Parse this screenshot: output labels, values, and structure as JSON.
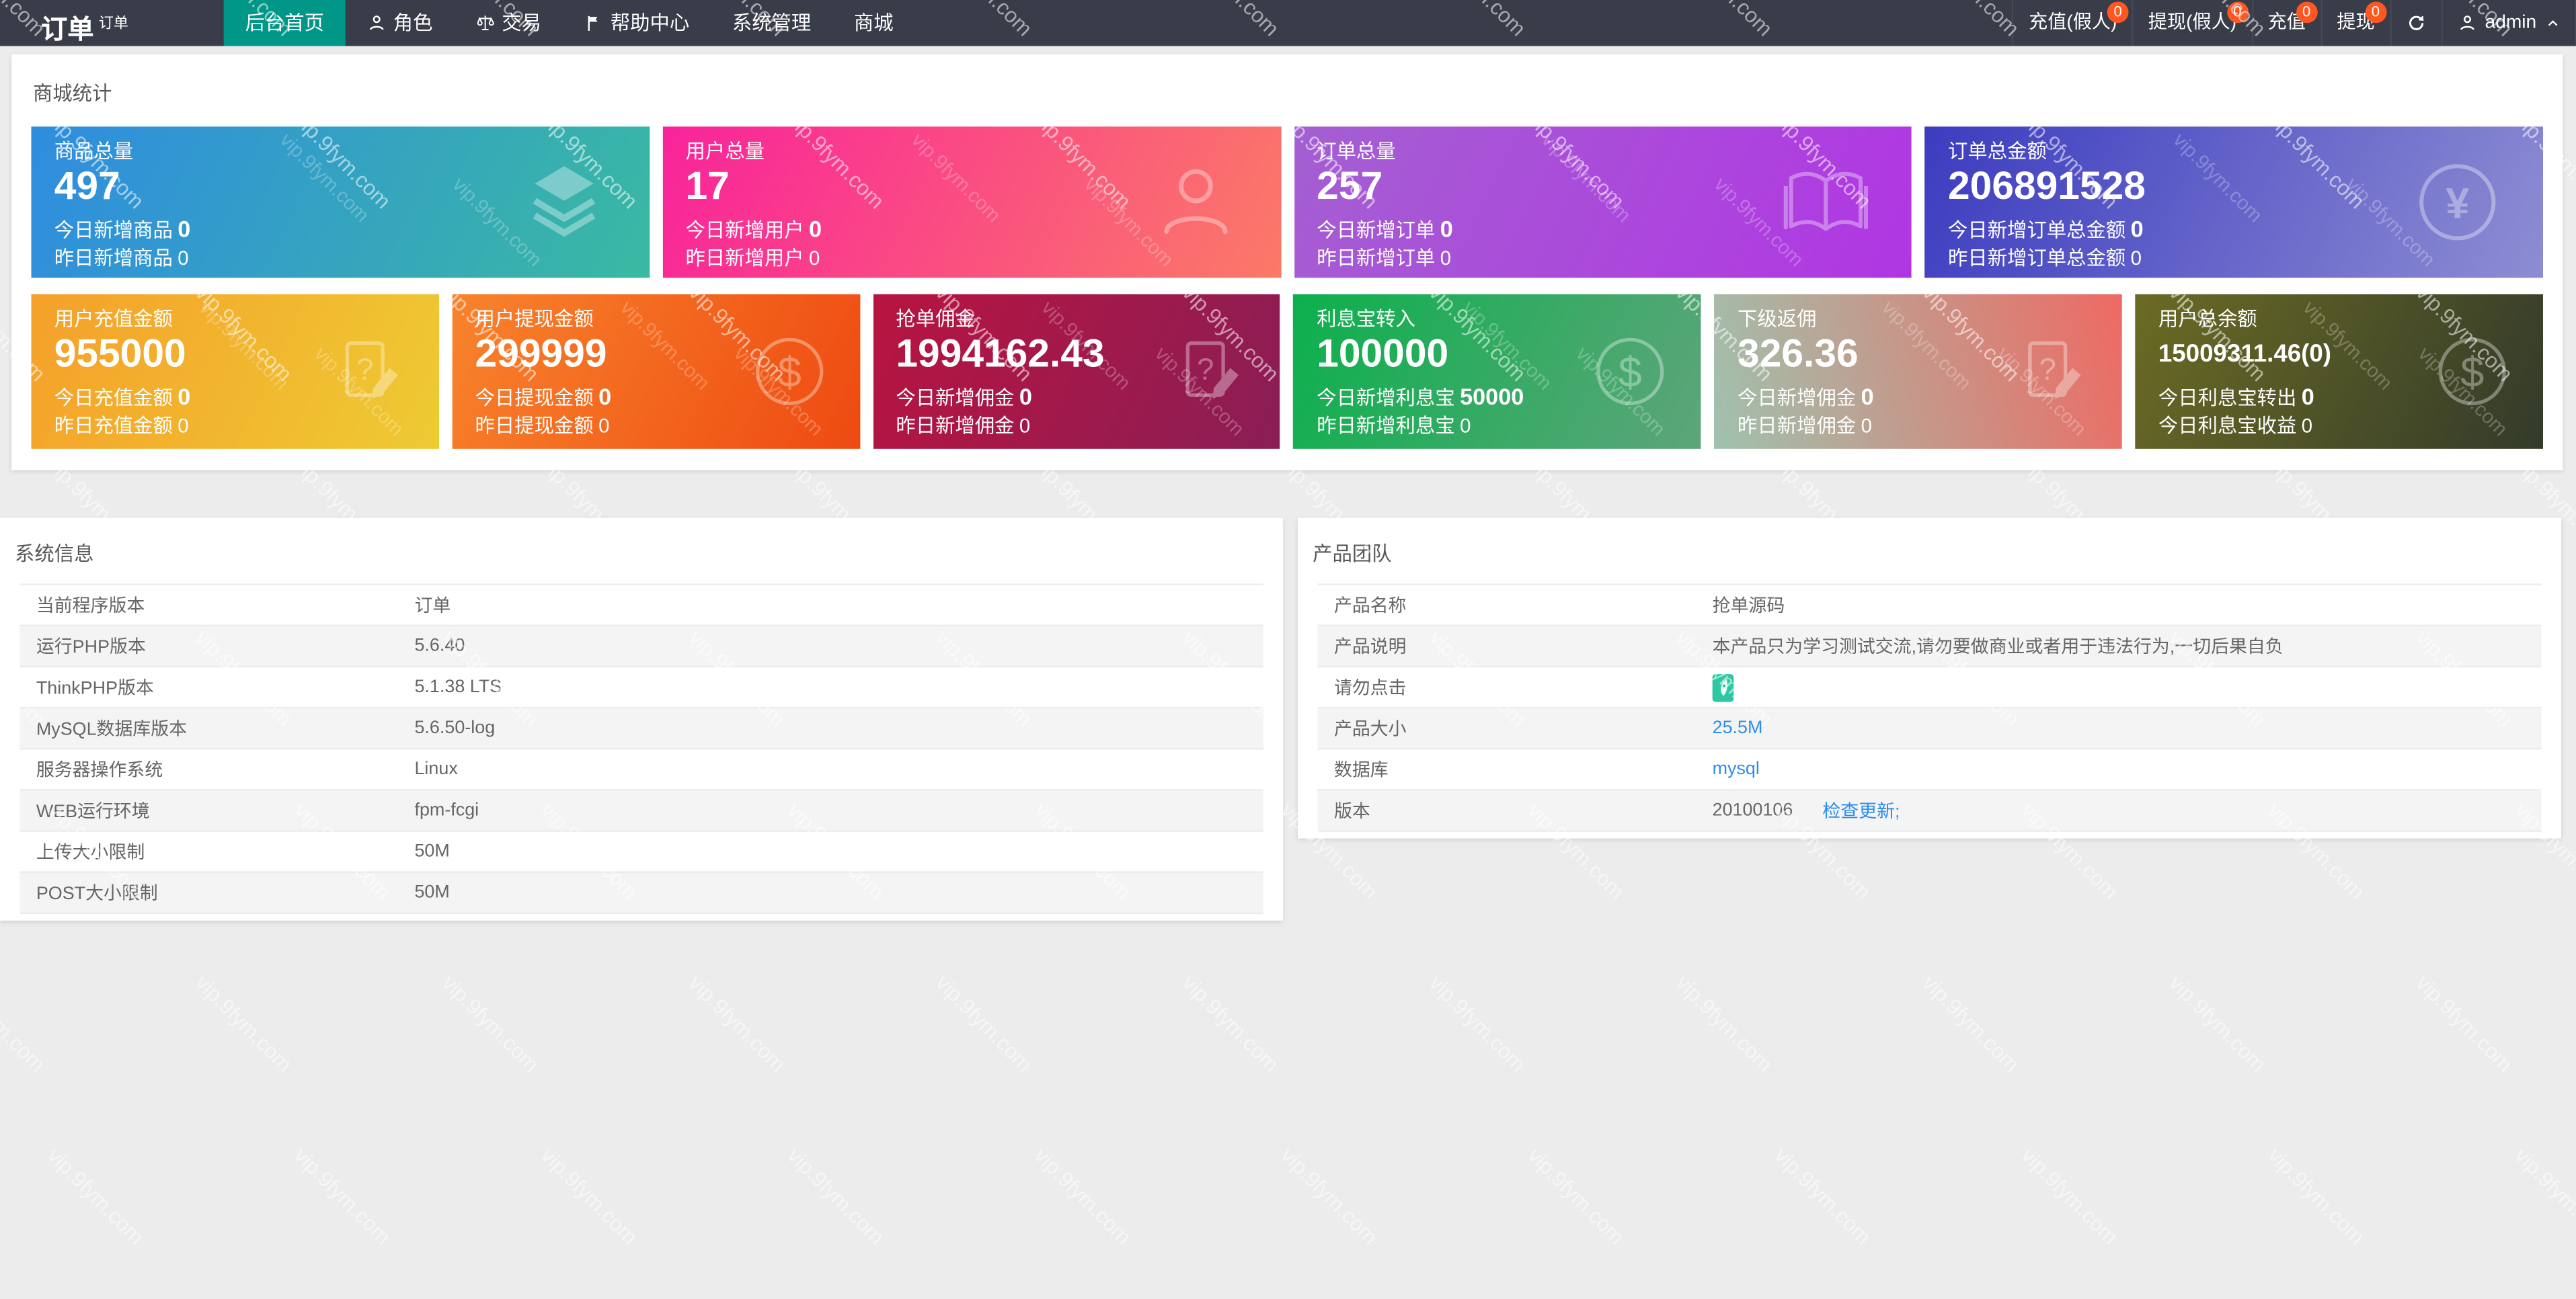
{
  "watermark": "vip.9fym.com",
  "colors": {
    "navbar_bg": "#393D49",
    "navbar_active": "#009688",
    "badge": "#FF5722",
    "link_blue": "#2d8cf0",
    "page_bg": "#ececec"
  },
  "navbar": {
    "title": "订单",
    "subtitle": "订单",
    "menu": [
      {
        "label": "后台首页",
        "active": true
      },
      {
        "label": "角色",
        "icon": "person"
      },
      {
        "label": "交易",
        "icon": "scale"
      },
      {
        "label": "帮助中心",
        "icon": "flag"
      },
      {
        "label": "系统管理"
      },
      {
        "label": "商城"
      }
    ],
    "right_items": [
      {
        "label": "充值(假人)",
        "badge": "0"
      },
      {
        "label": "提现(假人)",
        "badge": "0"
      },
      {
        "label": "充值",
        "badge": "0"
      },
      {
        "label": "提现",
        "badge": "0"
      }
    ],
    "user": "admin"
  },
  "stats_panel": {
    "title": "商城统计",
    "row1": [
      {
        "label": "商品总量",
        "value": "497",
        "line1_label": "今日新增商品",
        "line1_value": "0",
        "line2_label": "昨日新增商品",
        "line2_value": "0",
        "icon": "layers",
        "gradient": {
          "from": "#2f8ce0",
          "to": "#3ab9a2",
          "angle": 115
        }
      },
      {
        "label": "用户总量",
        "value": "17",
        "line1_label": "今日新增用户",
        "line1_value": "0",
        "line2_label": "昨日新增用户",
        "line2_value": "0",
        "icon": "user",
        "gradient": {
          "from": "#f9239b",
          "to": "#fb7a67",
          "angle": 115
        }
      },
      {
        "label": "订单总量",
        "value": "257",
        "line1_label": "今日新增订单",
        "line1_value": "0",
        "line2_label": "昨日新增订单",
        "line2_value": "0",
        "icon": "book",
        "gradient": {
          "from": "#a45fd2",
          "to": "#b136e3",
          "angle": 115
        }
      },
      {
        "label": "订单总金额",
        "value": "206891528",
        "line1_label": "今日新增订单总金额",
        "line1_value": "0",
        "line2_label": "昨日新增订单总金额",
        "line2_value": "0",
        "icon": "yen",
        "gradient": {
          "from": "#3c3cc0",
          "to": "#8d8dd3",
          "angle": 115
        }
      }
    ],
    "row2": [
      {
        "label": "用户充值金额",
        "value": "955000",
        "line1_label": "今日充值金额",
        "line1_value": "0",
        "line2_label": "昨日充值金额",
        "line2_value": "0",
        "icon": "doc-edit",
        "gradient": {
          "from": "#f5a02a",
          "to": "#eecb33",
          "angle": 115
        }
      },
      {
        "label": "用户提现金额",
        "value": "299999",
        "line1_label": "今日提现金额",
        "line1_value": "0",
        "line2_label": "昨日提现金额",
        "line2_value": "0",
        "icon": "dollar",
        "gradient": {
          "from": "#f8832c",
          "to": "#ee4a11",
          "angle": 115
        }
      },
      {
        "label": "抢单佣金",
        "value": "1994162.43",
        "line1_label": "今日新增佣金",
        "line1_value": "0",
        "line2_label": "昨日新增佣金",
        "line2_value": "0",
        "icon": "doc-edit",
        "gradient": {
          "from": "#b81440",
          "to": "#8a1e55",
          "angle": 115
        }
      },
      {
        "label": "利息宝转入",
        "value": "100000",
        "line1_label": "今日新增利息宝",
        "line1_value": "50000",
        "line2_label": "昨日新增利息宝",
        "line2_value": "0",
        "icon": "dollar",
        "gradient": {
          "from": "#0cb04d",
          "to": "#5da57a",
          "angle": 115
        }
      },
      {
        "label": "下级返佣",
        "value": "326.36",
        "line1_label": "今日新增佣金",
        "line1_value": "0",
        "line2_label": "昨日新增佣金",
        "line2_value": "0",
        "icon": "doc-edit",
        "gradient": {
          "from": "#9fc2ae",
          "to": "#ee6a63",
          "angle": 75
        }
      },
      {
        "label": "用户总余额",
        "value": "15009311.46(0)",
        "small_value": true,
        "line1_label": "今日利息宝转出",
        "line1_value": "0",
        "line2_label": "今日利息宝收益",
        "line2_value": "0",
        "icon": "dollar",
        "gradient": {
          "from": "#6b6b24",
          "to": "#333a2a",
          "angle": 115
        }
      }
    ]
  },
  "system_panel": {
    "title": "系统信息",
    "rows": [
      {
        "label": "当前程序版本",
        "value": "订单"
      },
      {
        "label": "运行PHP版本",
        "value": "5.6.40"
      },
      {
        "label": "ThinkPHP版本",
        "value": "5.1.38 LTS"
      },
      {
        "label": "MySQL数据库版本",
        "value": "5.6.50-log"
      },
      {
        "label": "服务器操作系统",
        "value": "Linux"
      },
      {
        "label": "WEB运行环境",
        "value": "fpm-fcgi"
      },
      {
        "label": "上传大小限制",
        "value": "50M"
      },
      {
        "label": "POST大小限制",
        "value": "50M"
      }
    ]
  },
  "product_panel": {
    "title": "产品团队",
    "rows": [
      {
        "label": "产品名称",
        "value": "抢单源码",
        "type": "text"
      },
      {
        "label": "产品说明",
        "value": "本产品只为学习测试交流,请勿要做商业或者用于违法行为,一切后果自负",
        "type": "text"
      },
      {
        "label": "请勿点击",
        "type": "icon",
        "icon": "rocket"
      },
      {
        "label": "产品大小",
        "value": "25.5M",
        "type": "link"
      },
      {
        "label": "数据库",
        "value": "mysql",
        "type": "link"
      },
      {
        "label": "版本",
        "value": "20100106",
        "link_text": "检查更新;",
        "type": "text_link"
      }
    ]
  }
}
